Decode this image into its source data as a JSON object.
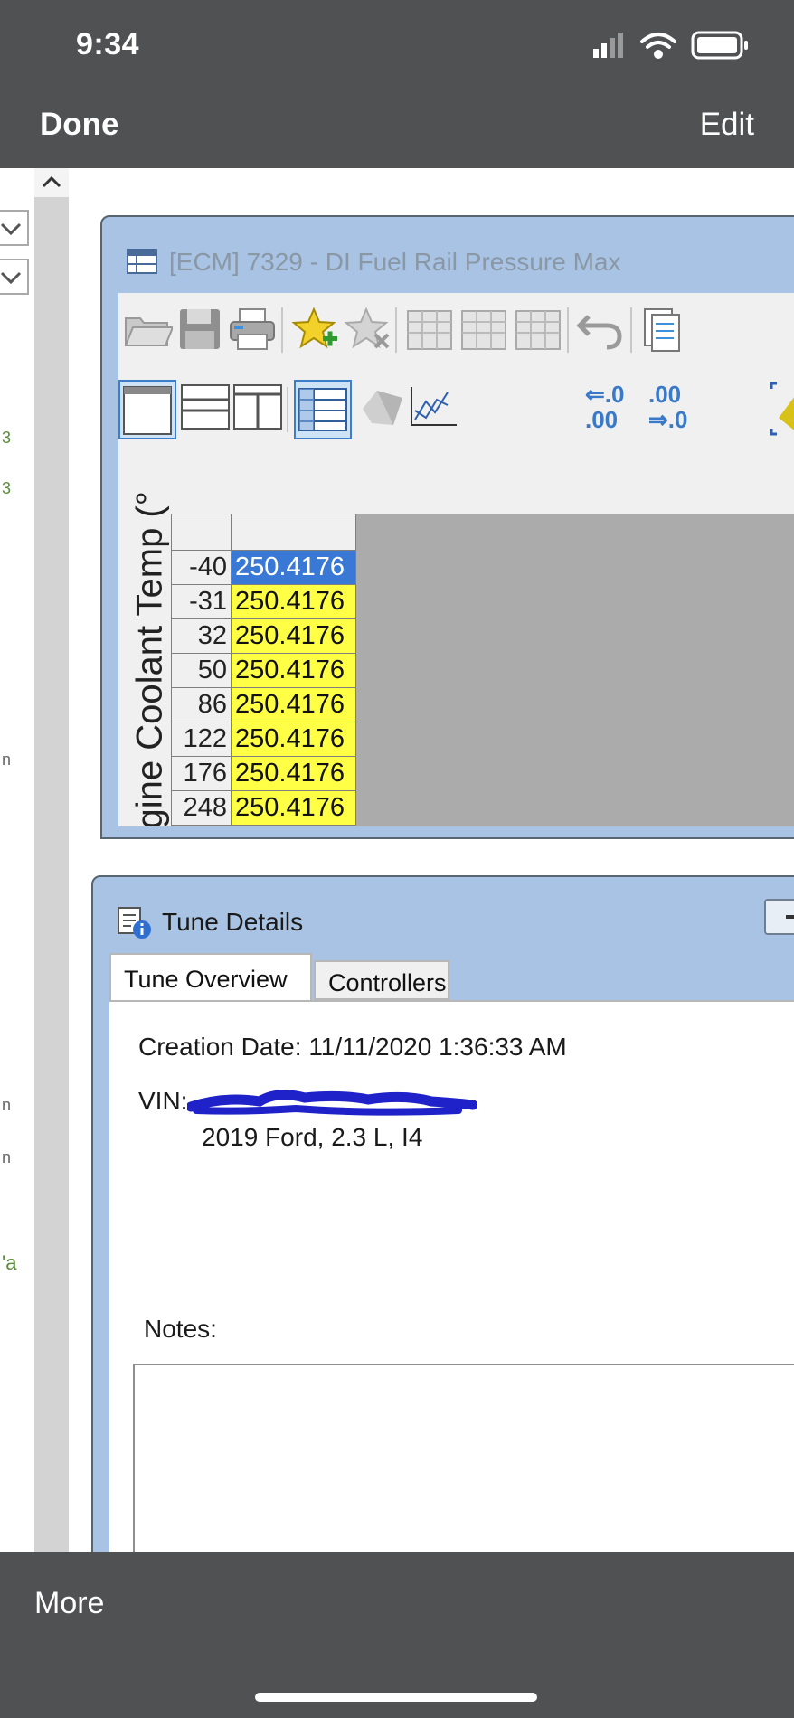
{
  "status_bar": {
    "time": "9:34"
  },
  "nav": {
    "done": "Done",
    "edit": "Edit"
  },
  "table_window": {
    "title": "[ECM] 7329 - DI Fuel Rail Pressure Max",
    "axis_label": "gine Coolant Temp (°",
    "round_labels": {
      "a": "⇐.0",
      "b": ".00",
      "c": ".00",
      "d": "⇒.0"
    },
    "rows": [
      {
        "temp": "-40",
        "value": "250.4176",
        "selected": true
      },
      {
        "temp": "-31",
        "value": "250.4176"
      },
      {
        "temp": "32",
        "value": "250.4176"
      },
      {
        "temp": "50",
        "value": "250.4176"
      },
      {
        "temp": "86",
        "value": "250.4176"
      },
      {
        "temp": "122",
        "value": "250.4176"
      },
      {
        "temp": "176",
        "value": "250.4176"
      },
      {
        "temp": "248",
        "value": "250.4176"
      }
    ],
    "colors": {
      "selected": "#3a78d6",
      "cell": "#ffff45"
    }
  },
  "tune_window": {
    "title": "Tune Details",
    "tabs": [
      "Tune Overview",
      "Controllers"
    ],
    "creation_date": "Creation Date: 11/11/2020 1:36:33 AM",
    "vin_label": "VIN:",
    "vehicle": "2019 Ford, 2.3 L, I4",
    "notes_label": "Notes:"
  },
  "left_pane": {
    "marks": [
      "3",
      "3",
      "n",
      "n",
      "n",
      "'a"
    ]
  },
  "bottom_bar": {
    "more": "More"
  }
}
